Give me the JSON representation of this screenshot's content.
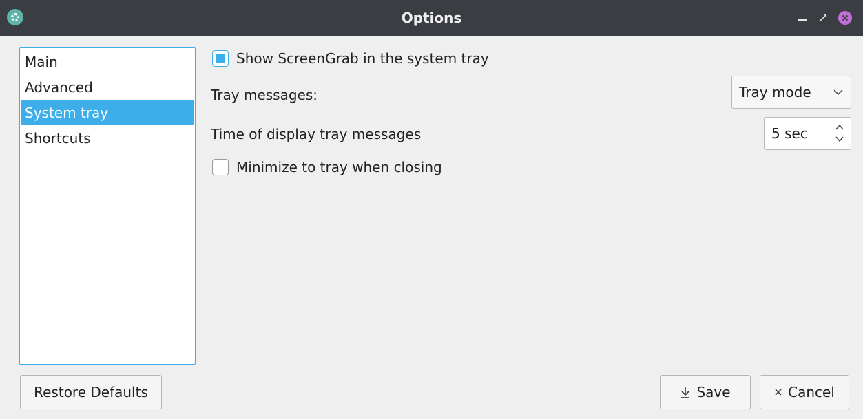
{
  "window": {
    "title": "Options",
    "close_color": "#c16fd8",
    "icons": [
      "app-icon",
      "minimize-icon",
      "restore-icon",
      "close-icon"
    ]
  },
  "sidebar": {
    "items": [
      {
        "label": "Main",
        "selected": false
      },
      {
        "label": "Advanced",
        "selected": false
      },
      {
        "label": "System tray",
        "selected": true
      },
      {
        "label": "Shortcuts",
        "selected": false
      }
    ],
    "accent": "#3daee9"
  },
  "settings": {
    "show_in_tray": {
      "label": "Show ScreenGrab in the system tray",
      "checked": true
    },
    "tray_messages": {
      "label": "Tray messages:",
      "value": "Tray mode"
    },
    "display_time": {
      "label": "Time of display tray messages",
      "value": "5 sec"
    },
    "minimize_to_tray": {
      "label": "Minimize to tray when closing",
      "checked": false
    }
  },
  "buttons": {
    "restore": "Restore Defaults",
    "save": "Save",
    "save_icon": "download-icon",
    "cancel": "Cancel",
    "cancel_icon": "close-icon"
  }
}
